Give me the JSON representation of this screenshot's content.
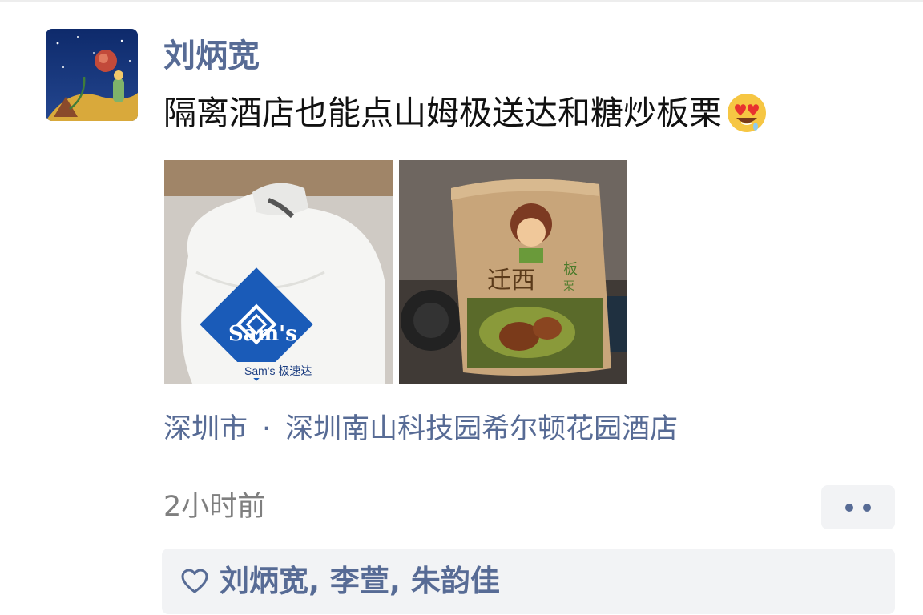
{
  "post": {
    "username": "刘炳宽",
    "text": "隔离酒店也能点山姆极送达和糖炒板栗",
    "emoji_icon": "heart-eyes-drooling-emoji",
    "photos": [
      {
        "icon": "sams-club-delivery-bag-photo",
        "caption": "Sam's"
      },
      {
        "icon": "roasted-chestnut-paper-bag-photo",
        "caption": "迁西板栗"
      }
    ],
    "location": {
      "city": "深圳市",
      "separator": "·",
      "place": "深圳南山科技园希尔顿花园酒店"
    },
    "time": "2小时前",
    "likes": {
      "names": "刘炳宽, 李萱, 朱韵佳"
    }
  },
  "colors": {
    "link": "#576b95",
    "time": "#7f7f7f",
    "panel": "#f2f3f5",
    "text": "#111111"
  },
  "icons": {
    "avatar": "little-prince-avatar",
    "more": "more-dots-icon",
    "like": "heart-outline-icon"
  }
}
